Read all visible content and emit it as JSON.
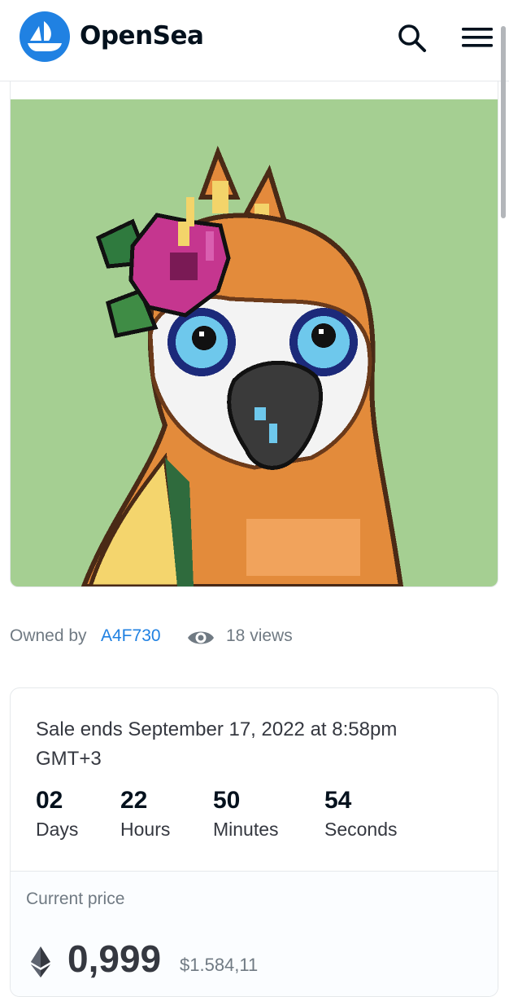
{
  "header": {
    "brand": "OpenSea",
    "logo_icon": "opensea-boat-icon",
    "search_icon": "search-icon",
    "menu_icon": "hamburger-menu-icon"
  },
  "nft": {
    "background_color": "#a5cf92",
    "subject": "pixel-art parrot with pink flower"
  },
  "ownership": {
    "owned_by_label": "Owned by",
    "owner": "A4F730",
    "views_icon": "eye-icon",
    "views": "18 views"
  },
  "sale": {
    "ends_text": "Sale ends September 17, 2022 at 8:58pm GMT+3",
    "countdown": [
      {
        "value": "02",
        "label": "Days"
      },
      {
        "value": "22",
        "label": "Hours"
      },
      {
        "value": "50",
        "label": "Minutes"
      },
      {
        "value": "54",
        "label": "Seconds"
      }
    ]
  },
  "price": {
    "label": "Current price",
    "currency_icon": "ethereum-icon",
    "value": "0,999",
    "usd": "$1.584,11"
  },
  "colors": {
    "accent": "#2081e2",
    "text_primary": "#04111d",
    "text_secondary": "#707a83",
    "border": "#e5e8eb"
  }
}
